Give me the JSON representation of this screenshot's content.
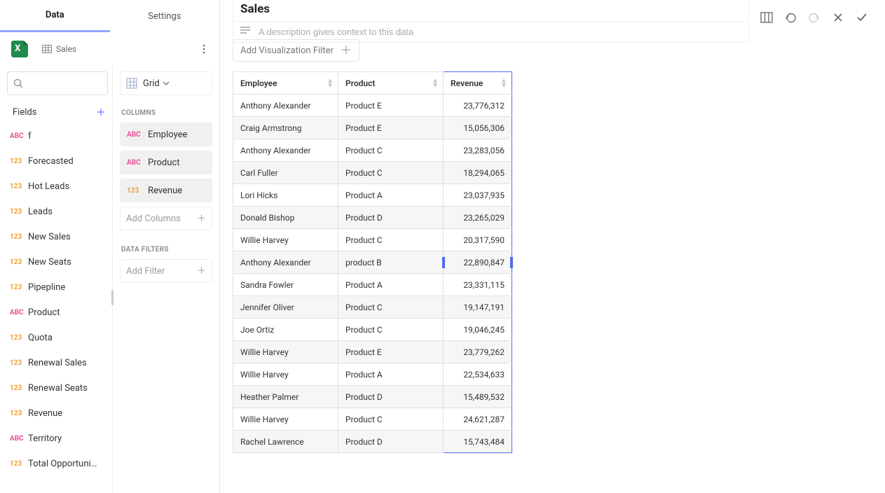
{
  "tabs": {
    "data": "Data",
    "settings": "Settings"
  },
  "source": {
    "sheet": "Sales"
  },
  "fields_header": "Fields",
  "fields": [
    {
      "type": "ABC",
      "name": "f"
    },
    {
      "type": "123",
      "name": "Forecasted"
    },
    {
      "type": "123",
      "name": "Hot Leads"
    },
    {
      "type": "123",
      "name": "Leads"
    },
    {
      "type": "123",
      "name": "New Sales"
    },
    {
      "type": "123",
      "name": "New Seats"
    },
    {
      "type": "123",
      "name": "Pipepline"
    },
    {
      "type": "ABC",
      "name": "Product"
    },
    {
      "type": "123",
      "name": "Quota"
    },
    {
      "type": "123",
      "name": "Renewal Sales"
    },
    {
      "type": "123",
      "name": "Renewal Seats"
    },
    {
      "type": "123",
      "name": "Revenue"
    },
    {
      "type": "ABC",
      "name": "Territory"
    },
    {
      "type": "123",
      "name": "Total Opportuni…"
    }
  ],
  "viz": {
    "name": "Grid"
  },
  "sections": {
    "columns": "COLUMNS",
    "filters": "DATA FILTERS"
  },
  "columns": [
    {
      "type": "ABC",
      "name": "Employee"
    },
    {
      "type": "ABC",
      "name": "Product"
    },
    {
      "type": "123",
      "name": "Revenue"
    }
  ],
  "placeholders": {
    "add_columns": "Add Columns",
    "add_filter": "Add Filter",
    "description": "A description gives context to this data",
    "add_viz_filter": "Add Visualization Filter"
  },
  "title": "Sales",
  "chart_data": {
    "type": "table",
    "columns": [
      "Employee",
      "Product",
      "Revenue"
    ],
    "rows": [
      [
        "Anthony Alexander",
        "Product E",
        "23,776,312"
      ],
      [
        "Craig Armstrong",
        "Product E",
        "15,056,306"
      ],
      [
        "Anthony Alexander",
        "Product C",
        "23,283,056"
      ],
      [
        "Carl Fuller",
        "Product C",
        "18,294,065"
      ],
      [
        "Lori Hicks",
        "Product A",
        "23,037,935"
      ],
      [
        "Donald Bishop",
        "Product D",
        "23,265,029"
      ],
      [
        "Willie Harvey",
        "Product C",
        "20,317,590"
      ],
      [
        "Anthony Alexander",
        "product B",
        "22,890,847"
      ],
      [
        "Sandra Fowler",
        "Product A",
        "23,331,115"
      ],
      [
        "Jennifer Oliver",
        "Product C",
        "19,147,191"
      ],
      [
        "Joe Ortiz",
        "Product C",
        "19,046,245"
      ],
      [
        "Willie Harvey",
        "Product E",
        "23,779,262"
      ],
      [
        "Willie Harvey",
        "Product A",
        "22,534,633"
      ],
      [
        "Heather Palmer",
        "Product D",
        "15,489,532"
      ],
      [
        "Willie Harvey",
        "Product C",
        "24,621,287"
      ],
      [
        "Rachel Lawrence",
        "Product D",
        "15,743,484"
      ]
    ]
  }
}
